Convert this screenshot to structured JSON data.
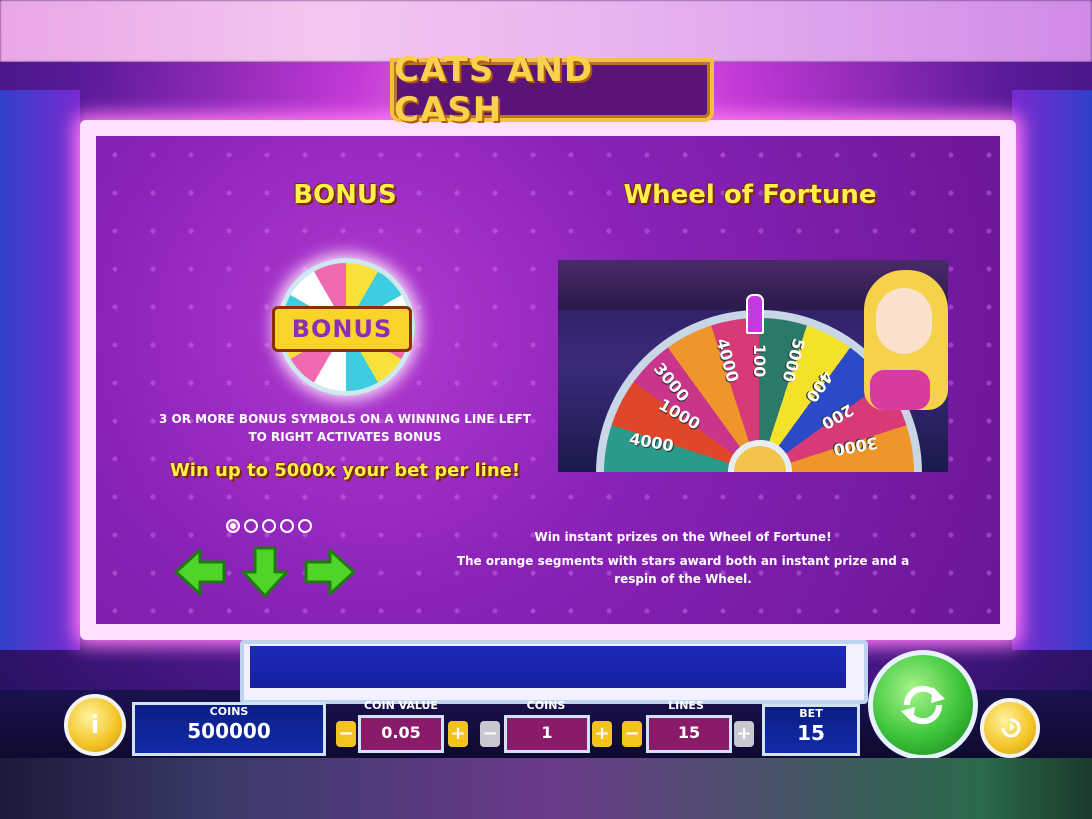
{
  "game": {
    "logo": "CATS AND CASH"
  },
  "info": {
    "bonus_title": "BONUS",
    "bonus_badge": "BONUS",
    "bonus_desc_1": "3 OR MORE BONUS SYMBOLS ON A WINNING LINE LEFT",
    "bonus_desc_2": "TO RIGHT ACTIVATES BONUS",
    "bonus_win": "Win up to 5000x your bet per line!",
    "wheel_title": "Wheel of Fortune",
    "wheel_desc_1": "Win instant prizes on the Wheel of Fortune!",
    "wheel_desc_2": "The orange segments with stars award both an instant prize and a",
    "wheel_desc_3": "respin of the Wheel.",
    "wheel_numbers": [
      "3000",
      "4000",
      "100",
      "5000",
      "400",
      "1000",
      "200",
      "4000",
      "3000"
    ],
    "pages_total": 5,
    "page_current": 1
  },
  "console": {
    "coins_label": "COINS",
    "coins_value": "500000",
    "coin_value_label": "COIN VALUE",
    "coin_value": "0.05",
    "coins_bet_label": "COINS",
    "coins_bet": "1",
    "lines_label": "LINES",
    "lines_value": "15",
    "bet_label": "BET",
    "bet_value": "15"
  },
  "icons": {
    "info": "info-icon",
    "spin": "spin-arrows-icon",
    "autoplay": "autoplay-icon",
    "prev": "arrow-left-icon",
    "down": "arrow-down-icon",
    "next": "arrow-right-icon"
  },
  "colors": {
    "title_yellow": "#fff04a",
    "arrow_green": "#4fd42a",
    "spin_green": "#3bc43a",
    "panel_purple": "#8a22b8",
    "console_blue": "#122aa8"
  }
}
